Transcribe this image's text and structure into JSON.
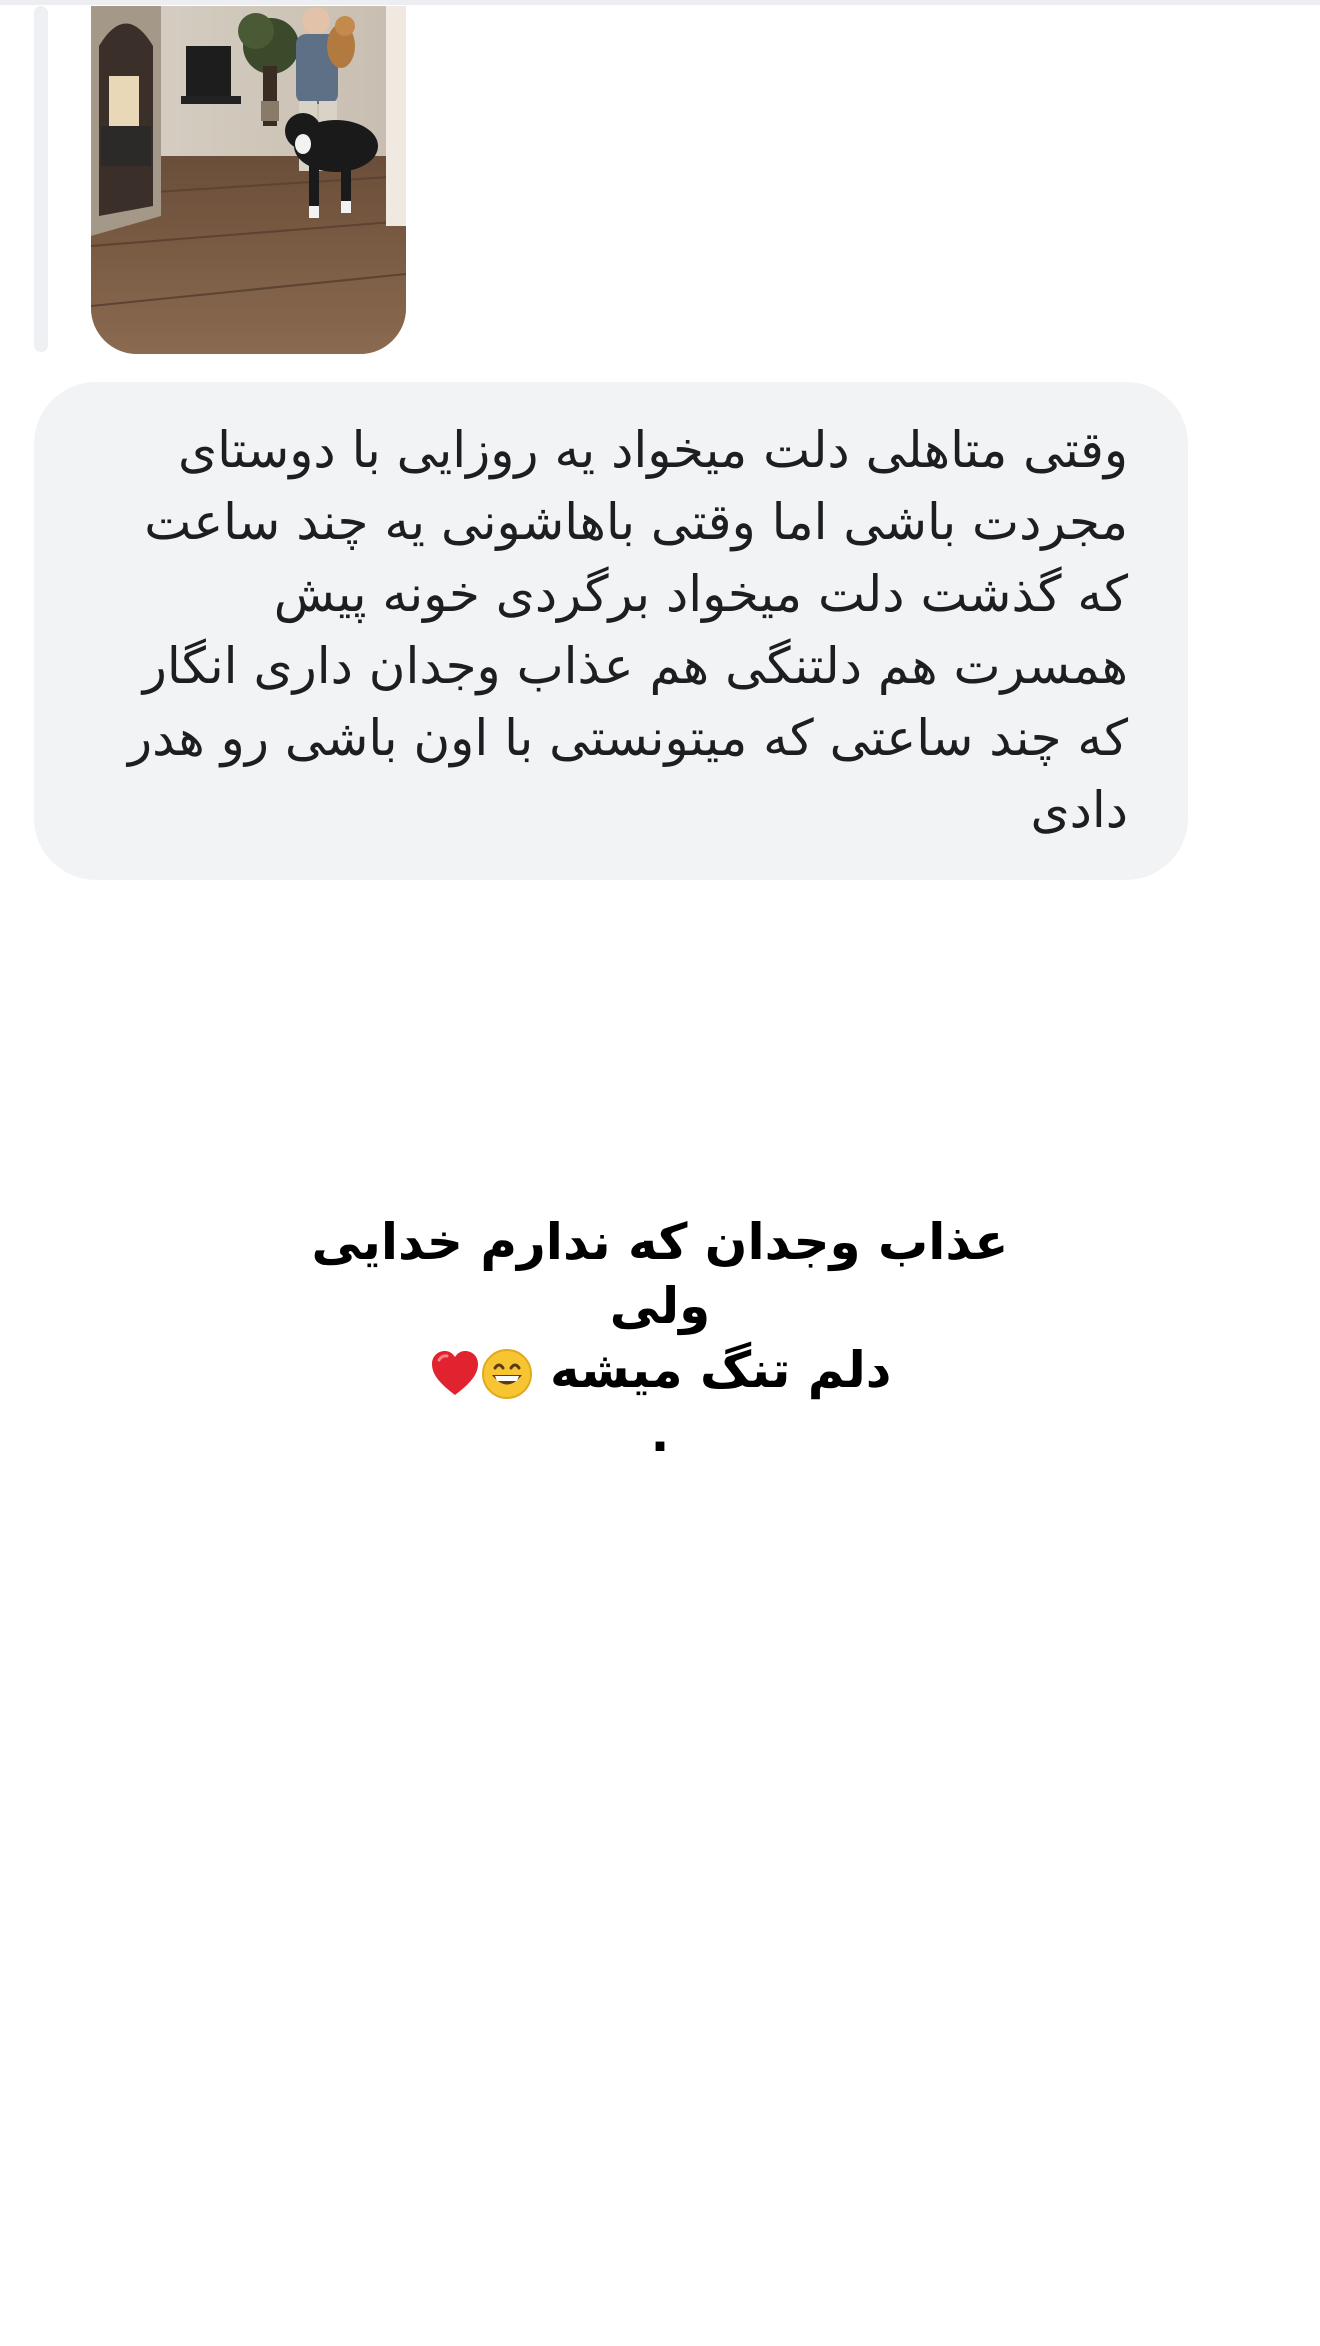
{
  "message": {
    "lines": [
      "وقتی متاهلی دلت میخواد یه روزایی با دوستای",
      "مجردت باشی اما وقتی باهاشونی یه چند ساعت",
      "که گذشت دلت میخواد برگردی خونه پیش",
      "همسرت هم دلتنگی هم عذاب وجدان داری انگار",
      "که چند ساعتی که میتونستی با اون باشی رو هدر",
      "دادی"
    ]
  },
  "caption": {
    "line1": "عذاب وجدان که ندارم خدایی ولی",
    "line2": "دلم تنگ میشه",
    "emoji_1": "grinning-face-icon",
    "emoji_2": "red-heart-icon",
    "period": "."
  },
  "colors": {
    "bubble_bg": "#f2f3f5",
    "bubble_text": "#1c1e21",
    "caption_text": "#000000",
    "page_bg": "#ffffff"
  }
}
